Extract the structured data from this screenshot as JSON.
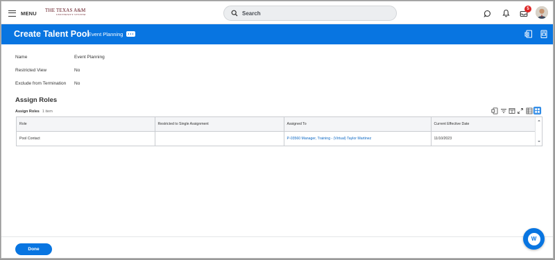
{
  "topbar": {
    "menu_label": "MENU",
    "logo_text": "THE TEXAS A&M",
    "logo_subtext": "UNIVERSITY SYSTEM",
    "search_placeholder": "Search",
    "icons": [
      "chat-icon",
      "bell-icon",
      "inbox-icon"
    ],
    "inbox_badge": "5"
  },
  "header": {
    "title": "Create Talent Pool",
    "subtitle": "Event Planning",
    "icons": [
      "excel-export-icon",
      "pdf-export-icon"
    ]
  },
  "fields": [
    {
      "label": "Name",
      "value": "Event Planning"
    },
    {
      "label": "Restricted View",
      "value": "No"
    },
    {
      "label": "Exclude from Termination",
      "value": "No"
    }
  ],
  "section": {
    "title": "Assign Roles",
    "grid_title": "Assign Roles",
    "grid_count": "1 item"
  },
  "table": {
    "columns": [
      "Role",
      "Restricted to Single Assignment",
      "Assigned To",
      "Current Effective Date"
    ],
    "rows": [
      [
        "Pool Contact",
        "",
        "P-03560 Manager, Training - (Virtual) Taylor Martinez",
        "11/10/2023"
      ]
    ]
  },
  "grid_tools": [
    "excel-export-icon",
    "filter-icon",
    "columns-icon",
    "fullscreen-icon",
    "list-view-icon",
    "grid-view-icon"
  ],
  "footer": {
    "done_label": "Done",
    "help_label": "W"
  },
  "colors": {
    "accent": "#0875e1",
    "badge": "#de2626",
    "link": "#0b67c4"
  }
}
